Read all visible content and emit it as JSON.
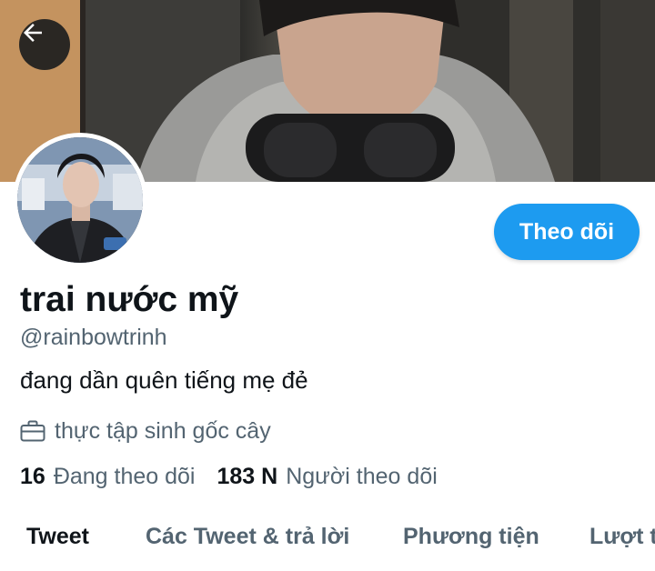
{
  "navigation": {
    "back_icon": "arrow-left-icon"
  },
  "profile": {
    "display_name": "trai nước mỹ",
    "handle": "@rainbowtrinh",
    "bio": "đang dần quên tiếng mẹ đẻ",
    "job_icon": "briefcase-icon",
    "job": "thực tập sinh gốc cây"
  },
  "actions": {
    "follow_label": "Theo dõi"
  },
  "stats": {
    "following_count": "16",
    "following_label": "Đang theo dõi",
    "followers_count": "183 N",
    "followers_label": "Người theo dõi"
  },
  "tabs": [
    {
      "label": "Tweet",
      "active": true
    },
    {
      "label": "Các Tweet & trả lời",
      "active": false
    },
    {
      "label": "Phương tiện",
      "active": false
    },
    {
      "label": "Lượt t",
      "active": false
    }
  ],
  "colors": {
    "accent": "#1d9bf0",
    "text_primary": "#0f1419",
    "text_secondary": "#536471",
    "background": "#ffffff"
  }
}
